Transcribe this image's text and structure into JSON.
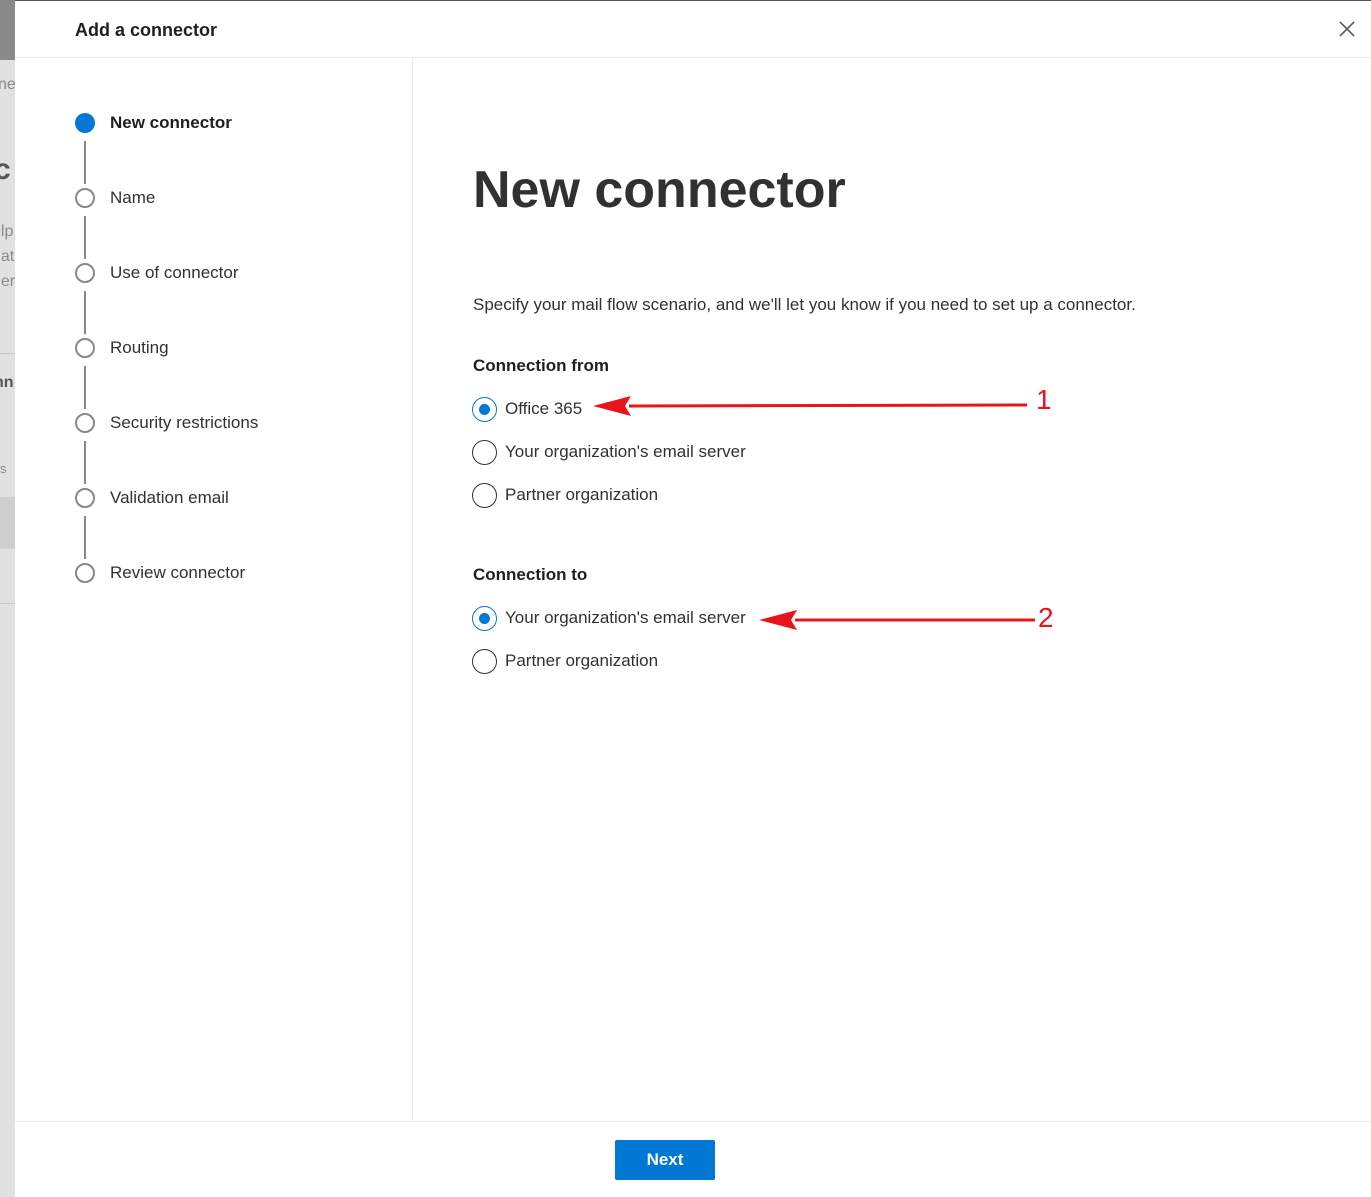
{
  "background_page": {
    "fragments": [
      "ne",
      "c",
      "elp",
      "nat",
      "ner",
      "nn",
      "s"
    ]
  },
  "panel": {
    "title": "Add a connector",
    "close_icon": "close-icon"
  },
  "steps": [
    {
      "label": "New connector",
      "active": true
    },
    {
      "label": "Name",
      "active": false
    },
    {
      "label": "Use of connector",
      "active": false
    },
    {
      "label": "Routing",
      "active": false
    },
    {
      "label": "Security restrictions",
      "active": false
    },
    {
      "label": "Validation email",
      "active": false
    },
    {
      "label": "Review connector",
      "active": false
    }
  ],
  "main": {
    "title": "New connector",
    "description": "Specify your mail flow scenario, and we'll let you know if you need to set up a connector.",
    "connection_from": {
      "label": "Connection from",
      "options": [
        "Office 365",
        "Your organization's email server",
        "Partner organization"
      ],
      "selected": "Office 365"
    },
    "connection_to": {
      "label": "Connection to",
      "options": [
        "Your organization's email server",
        "Partner organization"
      ],
      "selected": "Your organization's email server"
    }
  },
  "annotations": {
    "first": "1",
    "second": "2",
    "color": "#e8141a"
  },
  "footer": {
    "next_label": "Next"
  },
  "colors": {
    "accent": "#0078d4"
  }
}
